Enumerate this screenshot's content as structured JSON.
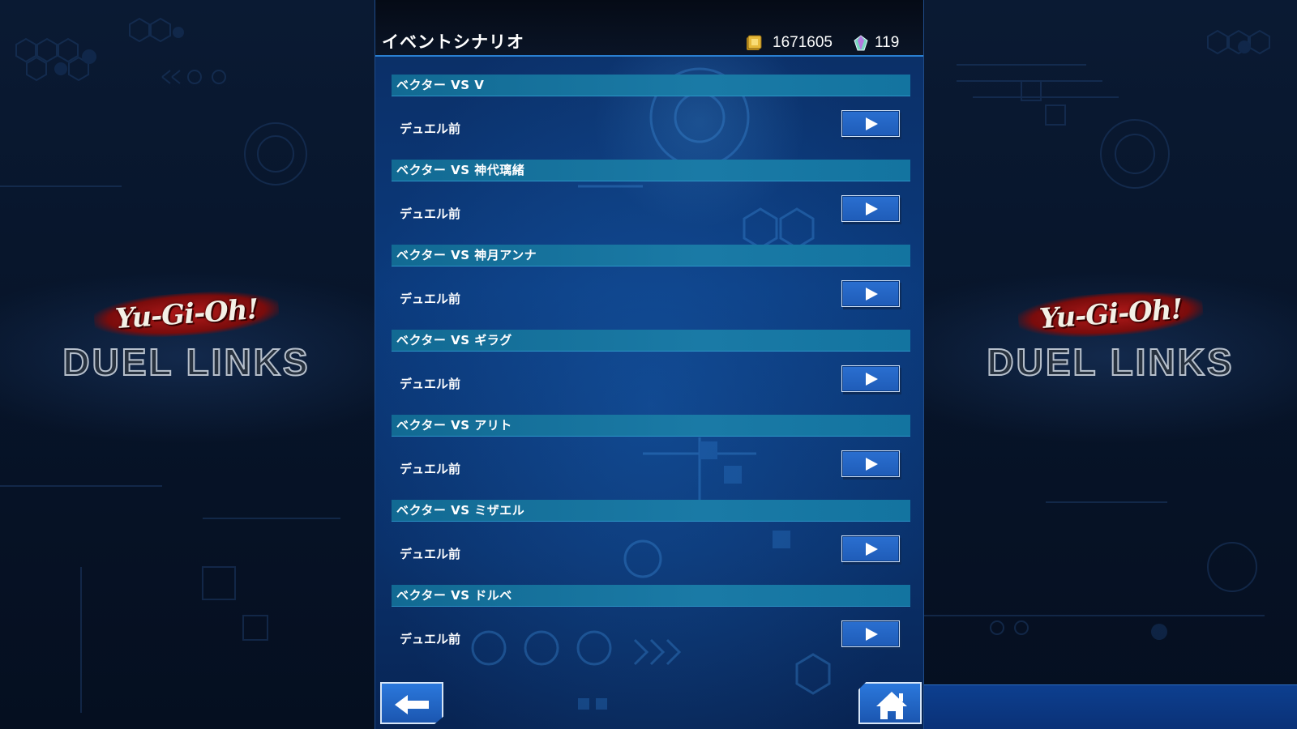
{
  "header": {
    "title": "イベントシナリオ",
    "gold": "1671605",
    "gems": "119"
  },
  "entries": [
    {
      "title": "ベクター VS V",
      "subtitle": "デュエル前"
    },
    {
      "title": "ベクター VS 神代璃緒",
      "subtitle": "デュエル前"
    },
    {
      "title": "ベクター VS 神月アンナ",
      "subtitle": "デュエル前"
    },
    {
      "title": "ベクター VS ギラグ",
      "subtitle": "デュエル前"
    },
    {
      "title": "ベクター VS アリト",
      "subtitle": "デュエル前"
    },
    {
      "title": "ベクター VS ミザエル",
      "subtitle": "デュエル前"
    },
    {
      "title": "ベクター VS ドルベ",
      "subtitle": "デュエル前"
    }
  ],
  "logo": {
    "top_text": "Yu-Gi-Oh!",
    "bottom_text": "DUEL LINKS"
  },
  "icons": {
    "play": "play-icon",
    "back": "back-arrow-icon",
    "home": "home-icon",
    "gold": "gold-coin-icon",
    "gems": "gem-icon"
  },
  "colors": {
    "panel": "#0b3a7c",
    "entry_header": "#1a7aa6",
    "button": "#2a6fd0"
  }
}
